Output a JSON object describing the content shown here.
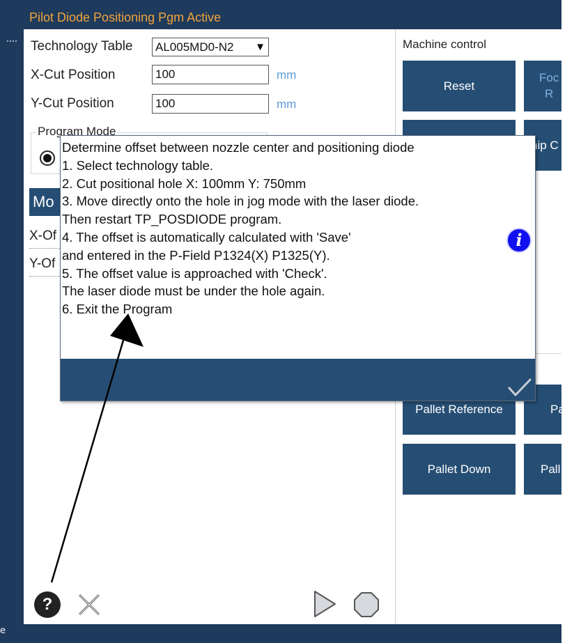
{
  "app": {
    "title": "Pilot Diode Positioning Pgm Active"
  },
  "form": {
    "technology_table_label": "Technology Table",
    "technology_table_value": "AL005MD0-N2",
    "technology_table_arrow": "▼",
    "x_cut_label": "X-Cut Position",
    "x_cut_value": "100",
    "x_cut_unit": "mm",
    "y_cut_label": "Y-Cut Position",
    "y_cut_value": "100",
    "y_cut_unit": "mm",
    "program_mode_label": "Program Mode",
    "mode_bar_text": "Mo",
    "x_offset_label": "X-Of",
    "y_offset_label": "Y-Of"
  },
  "machine_control": {
    "label": "Machine control",
    "buttons": {
      "reset": "Reset",
      "focus_partial": "Foc\nR",
      "chip_partial": "hip C",
      "pallet_reference": "Pallet Reference",
      "pallet_ref_partial": "Pa",
      "pallet_down": "Pallet Down",
      "pallet_down_partial": "Pall"
    }
  },
  "dialog": {
    "text": "Determine offset between nozzle center and positioning diode\n1. Select technology table.\n2. Cut positional hole X: 100mm Y: 750mm\n3. Move directly onto the hole in jog mode with the laser diode.\nThen restart TP_POSDIODE program.\n4. The offset is automatically calculated with 'Save'\nand entered in the P-Field P1324(X) P1325(Y).\n5. The offset value is approached with 'Check'.\nThe laser diode must be under the hole again.\n6. Exit the Program",
    "info_glyph": "i"
  },
  "bottom": {
    "help_glyph": "?",
    "edge_char": "e"
  },
  "icons": {
    "info": "info-icon",
    "confirm": "checkmark-icon",
    "help": "question-icon",
    "close": "close-icon",
    "play": "play-icon",
    "stop": "stop-icon"
  },
  "colors": {
    "frame": "#1e3a5c",
    "button": "#264e74",
    "title_text": "#f0a43a",
    "unit_text": "#5b9bd5",
    "info_blue": "#1010f0"
  }
}
